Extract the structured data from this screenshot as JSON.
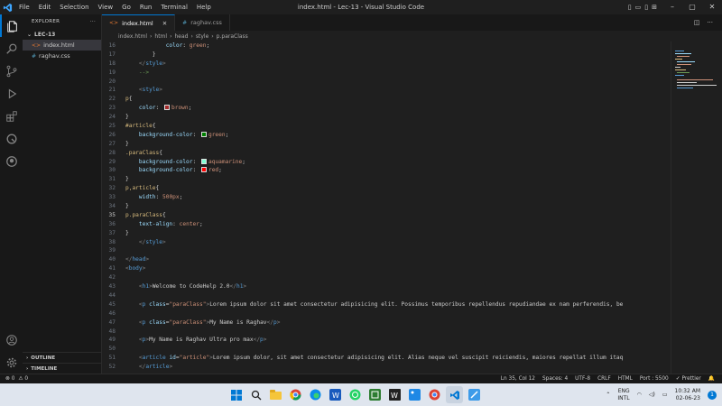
{
  "titlebar": {
    "menu": [
      "File",
      "Edit",
      "Selection",
      "View",
      "Go",
      "Run",
      "Terminal",
      "Help"
    ],
    "title": "index.html - Lec-13 - Visual Studio Code"
  },
  "activity_bar": {
    "icons": [
      "explorer-icon",
      "search-icon",
      "source-control-icon",
      "run-debug-icon",
      "extensions-icon",
      "testing-icon",
      "github-icon"
    ],
    "bottom_icons": [
      "account-icon",
      "settings-gear-icon"
    ]
  },
  "sidebar": {
    "header": "EXPLORER",
    "folder": "LEC-13",
    "files": [
      {
        "name": "index.html",
        "icon": "<>",
        "type": "html",
        "active": true
      },
      {
        "name": "raghav.css",
        "icon": "#",
        "type": "css",
        "active": false
      }
    ],
    "outline": "OUTLINE",
    "timeline": "TIMELINE"
  },
  "tabs": [
    {
      "label": "index.html",
      "icon": "<>",
      "active": true
    },
    {
      "label": "raghav.css",
      "icon": "#",
      "active": false
    }
  ],
  "breadcrumb": [
    "index.html",
    "html",
    "head",
    "style",
    "p.paraClass"
  ],
  "editor": {
    "lines": [
      {
        "n": "16",
        "tokens": [
          [
            "            ",
            ""
          ],
          [
            "color",
            "tk-prop"
          ],
          [
            ": ",
            ""
          ],
          [
            "green",
            "tk-val"
          ],
          [
            ";",
            ""
          ]
        ]
      },
      {
        "n": "17",
        "tokens": [
          [
            "        }",
            ""
          ]
        ]
      },
      {
        "n": "18",
        "tokens": [
          [
            "    </",
            "tk-punc"
          ],
          [
            "style",
            "tk-tag"
          ],
          [
            ">",
            "tk-punc"
          ]
        ]
      },
      {
        "n": "19",
        "tokens": [
          [
            "    -->",
            "tk-cmt"
          ]
        ]
      },
      {
        "n": "20",
        "tokens": []
      },
      {
        "n": "21",
        "tokens": [
          [
            "    <",
            "tk-punc"
          ],
          [
            "style",
            "tk-tag"
          ],
          [
            ">",
            "tk-punc"
          ]
        ]
      },
      {
        "n": "22",
        "tokens": [
          [
            "p",
            "tk-sel"
          ],
          [
            "{",
            ""
          ]
        ]
      },
      {
        "n": "23",
        "tokens": [
          [
            "    ",
            ""
          ],
          [
            "color",
            "tk-prop"
          ],
          [
            ": ",
            ""
          ],
          [
            "#a52a2a",
            "swatch"
          ],
          [
            "brown",
            "tk-val"
          ],
          [
            ";",
            ""
          ]
        ]
      },
      {
        "n": "24",
        "tokens": [
          [
            "}",
            ""
          ]
        ]
      },
      {
        "n": "25",
        "tokens": [
          [
            "#article",
            "tk-sel"
          ],
          [
            "{",
            ""
          ]
        ]
      },
      {
        "n": "26",
        "tokens": [
          [
            "    ",
            ""
          ],
          [
            "background-color",
            "tk-prop"
          ],
          [
            ": ",
            ""
          ],
          [
            "#008000",
            "swatch"
          ],
          [
            "green",
            "tk-val"
          ],
          [
            ";",
            ""
          ]
        ]
      },
      {
        "n": "27",
        "tokens": [
          [
            "}",
            ""
          ]
        ]
      },
      {
        "n": "28",
        "tokens": [
          [
            ".paraClass",
            "tk-sel"
          ],
          [
            "{",
            ""
          ]
        ]
      },
      {
        "n": "29",
        "tokens": [
          [
            "    ",
            ""
          ],
          [
            "background-color",
            "tk-prop"
          ],
          [
            ": ",
            ""
          ],
          [
            "#7fffd4",
            "swatch"
          ],
          [
            "aquamarine",
            "tk-val"
          ],
          [
            ";",
            ""
          ]
        ]
      },
      {
        "n": "30",
        "tokens": [
          [
            "    ",
            ""
          ],
          [
            "background-color",
            "tk-prop"
          ],
          [
            ": ",
            ""
          ],
          [
            "#ff0000",
            "swatch"
          ],
          [
            "red",
            "tk-val"
          ],
          [
            ";",
            ""
          ]
        ]
      },
      {
        "n": "31",
        "tokens": [
          [
            "}",
            ""
          ]
        ]
      },
      {
        "n": "32",
        "tokens": [
          [
            "p,article",
            "tk-sel"
          ],
          [
            "{",
            ""
          ]
        ]
      },
      {
        "n": "33",
        "tokens": [
          [
            "    ",
            ""
          ],
          [
            "width",
            "tk-prop"
          ],
          [
            ": ",
            ""
          ],
          [
            "500px",
            "tk-val"
          ],
          [
            ";",
            ""
          ]
        ]
      },
      {
        "n": "34",
        "tokens": [
          [
            "}",
            ""
          ]
        ]
      },
      {
        "n": "35",
        "tokens": [
          [
            "p.paraClass",
            "tk-sel"
          ],
          [
            "{",
            ""
          ]
        ],
        "current": true
      },
      {
        "n": "36",
        "tokens": [
          [
            "    ",
            ""
          ],
          [
            "text-align",
            "tk-prop"
          ],
          [
            ": ",
            ""
          ],
          [
            "center",
            "tk-val"
          ],
          [
            ";",
            ""
          ]
        ]
      },
      {
        "n": "37",
        "tokens": [
          [
            "}",
            ""
          ]
        ]
      },
      {
        "n": "38",
        "tokens": [
          [
            "    </",
            "tk-punc"
          ],
          [
            "style",
            "tk-tag"
          ],
          [
            ">",
            "tk-punc"
          ]
        ]
      },
      {
        "n": "39",
        "tokens": []
      },
      {
        "n": "40",
        "tokens": [
          [
            "</",
            "tk-punc"
          ],
          [
            "head",
            "tk-tag"
          ],
          [
            ">",
            "tk-punc"
          ]
        ]
      },
      {
        "n": "41",
        "tokens": [
          [
            "<",
            "tk-punc"
          ],
          [
            "body",
            "tk-tag"
          ],
          [
            ">",
            "tk-punc"
          ]
        ]
      },
      {
        "n": "42",
        "tokens": []
      },
      {
        "n": "43",
        "tokens": [
          [
            "    <",
            "tk-punc"
          ],
          [
            "h1",
            "tk-tag"
          ],
          [
            ">",
            "tk-punc"
          ],
          [
            "Welcome to CodeHelp 2.0",
            ""
          ],
          [
            "</",
            "tk-punc"
          ],
          [
            "h1",
            "tk-tag"
          ],
          [
            ">",
            "tk-punc"
          ]
        ]
      },
      {
        "n": "44",
        "tokens": []
      },
      {
        "n": "45",
        "tokens": [
          [
            "    <",
            "tk-punc"
          ],
          [
            "p",
            "tk-tag"
          ],
          [
            " ",
            ""
          ],
          [
            "class",
            "tk-attr"
          ],
          [
            "=",
            ""
          ],
          [
            "\"paraClass\"",
            "tk-str"
          ],
          [
            ">",
            "tk-punc"
          ],
          [
            "Lorem ipsum dolor sit amet consectetur adipisicing elit. Possimus temporibus repellendus repudiandae ex nam perferendis, be",
            ""
          ]
        ]
      },
      {
        "n": "46",
        "tokens": []
      },
      {
        "n": "47",
        "tokens": [
          [
            "    <",
            "tk-punc"
          ],
          [
            "p",
            "tk-tag"
          ],
          [
            " ",
            ""
          ],
          [
            "class",
            "tk-attr"
          ],
          [
            "=",
            ""
          ],
          [
            "\"paraClass\"",
            "tk-str"
          ],
          [
            ">",
            "tk-punc"
          ],
          [
            "My Name is Raghav",
            ""
          ],
          [
            "</",
            "tk-punc"
          ],
          [
            "p",
            "tk-tag"
          ],
          [
            ">",
            "tk-punc"
          ]
        ]
      },
      {
        "n": "48",
        "tokens": []
      },
      {
        "n": "49",
        "tokens": [
          [
            "    <",
            "tk-punc"
          ],
          [
            "p",
            "tk-tag"
          ],
          [
            ">",
            "tk-punc"
          ],
          [
            "My Name is Raghav Ultra pro max",
            ""
          ],
          [
            "</",
            "tk-punc"
          ],
          [
            "p",
            "tk-tag"
          ],
          [
            ">",
            "tk-punc"
          ]
        ]
      },
      {
        "n": "50",
        "tokens": []
      },
      {
        "n": "51",
        "tokens": [
          [
            "    <",
            "tk-punc"
          ],
          [
            "article",
            "tk-tag"
          ],
          [
            " ",
            ""
          ],
          [
            "id",
            "tk-attr"
          ],
          [
            "=",
            ""
          ],
          [
            "\"article\"",
            "tk-str"
          ],
          [
            ">",
            "tk-punc"
          ],
          [
            "Lorem ipsum dolor, sit amet consectetur adipisicing elit. Alias neque vel suscipit reiciendis, maiores repellat illum itaq",
            ""
          ]
        ]
      },
      {
        "n": "52",
        "tokens": [
          [
            "    </",
            "tk-punc"
          ],
          [
            "article",
            "tk-tag"
          ],
          [
            ">",
            "tk-punc"
          ]
        ]
      }
    ]
  },
  "statusbar": {
    "errors": "⊗ 0",
    "warnings": "⚠ 0",
    "position": "Ln 35, Col 12",
    "spaces": "Spaces: 4",
    "encoding": "UTF-8",
    "eol": "CRLF",
    "language": "HTML",
    "port": "Port : 5500",
    "prettier": "✓ Prettier",
    "bell": "🔔"
  },
  "taskbar": {
    "lang_top": "ENG",
    "lang_bottom": "INTL",
    "time": "10:32 AM",
    "date": "02-06-23"
  },
  "colors": {
    "accent": "#0078d4",
    "editor_bg": "#1f1f1f",
    "sidebar_bg": "#181818",
    "taskbar_bg": "#dfe5ee"
  }
}
